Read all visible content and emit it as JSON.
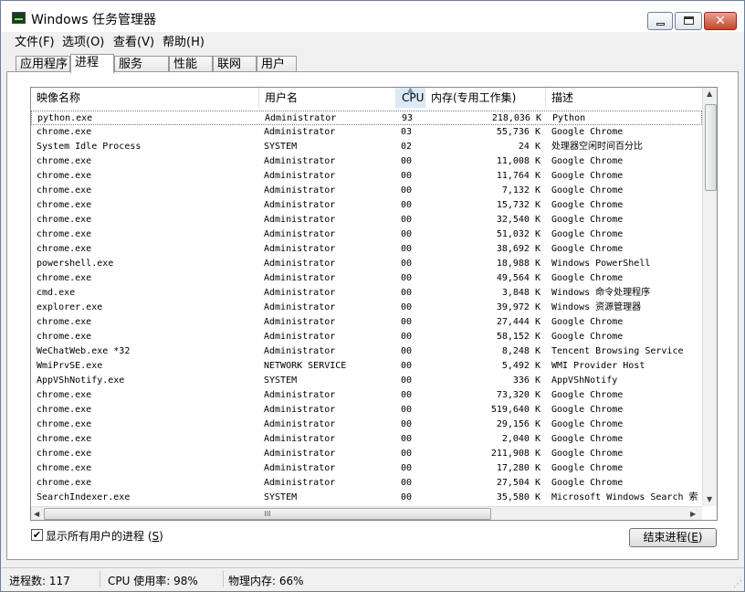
{
  "window": {
    "title": "Windows 任务管理器"
  },
  "menu": [
    "文件(F)",
    "选项(O)",
    "查看(V)",
    "帮助(H)"
  ],
  "tabs": [
    "应用程序",
    "进程",
    "服务",
    "性能",
    "联网",
    "用户"
  ],
  "active_tab": "进程",
  "columns": {
    "name": "映像名称",
    "user": "用户名",
    "cpu": "CPU",
    "mem": "内存(专用工作集)",
    "desc": "描述"
  },
  "sorted_column": "CPU",
  "processes": [
    {
      "name": "python.exe",
      "user": "Administrator",
      "cpu": "93",
      "mem": "218,036 K",
      "desc": "Python"
    },
    {
      "name": "chrome.exe",
      "user": "Administrator",
      "cpu": "03",
      "mem": "55,736 K",
      "desc": "Google Chrome"
    },
    {
      "name": "System Idle Process",
      "user": "SYSTEM",
      "cpu": "02",
      "mem": "24 K",
      "desc": "处理器空闲时间百分比"
    },
    {
      "name": "chrome.exe",
      "user": "Administrator",
      "cpu": "00",
      "mem": "11,008 K",
      "desc": "Google Chrome"
    },
    {
      "name": "chrome.exe",
      "user": "Administrator",
      "cpu": "00",
      "mem": "11,764 K",
      "desc": "Google Chrome"
    },
    {
      "name": "chrome.exe",
      "user": "Administrator",
      "cpu": "00",
      "mem": "7,132 K",
      "desc": "Google Chrome"
    },
    {
      "name": "chrome.exe",
      "user": "Administrator",
      "cpu": "00",
      "mem": "15,732 K",
      "desc": "Google Chrome"
    },
    {
      "name": "chrome.exe",
      "user": "Administrator",
      "cpu": "00",
      "mem": "32,540 K",
      "desc": "Google Chrome"
    },
    {
      "name": "chrome.exe",
      "user": "Administrator",
      "cpu": "00",
      "mem": "51,032 K",
      "desc": "Google Chrome"
    },
    {
      "name": "chrome.exe",
      "user": "Administrator",
      "cpu": "00",
      "mem": "38,692 K",
      "desc": "Google Chrome"
    },
    {
      "name": "powershell.exe",
      "user": "Administrator",
      "cpu": "00",
      "mem": "18,988 K",
      "desc": "Windows PowerShell"
    },
    {
      "name": "chrome.exe",
      "user": "Administrator",
      "cpu": "00",
      "mem": "49,564 K",
      "desc": "Google Chrome"
    },
    {
      "name": "cmd.exe",
      "user": "Administrator",
      "cpu": "00",
      "mem": "3,848 K",
      "desc": "Windows 命令处理程序"
    },
    {
      "name": "explorer.exe",
      "user": "Administrator",
      "cpu": "00",
      "mem": "39,972 K",
      "desc": "Windows 资源管理器"
    },
    {
      "name": "chrome.exe",
      "user": "Administrator",
      "cpu": "00",
      "mem": "27,444 K",
      "desc": "Google Chrome"
    },
    {
      "name": "chrome.exe",
      "user": "Administrator",
      "cpu": "00",
      "mem": "58,152 K",
      "desc": "Google Chrome"
    },
    {
      "name": "WeChatWeb.exe *32",
      "user": "Administrator",
      "cpu": "00",
      "mem": "8,248 K",
      "desc": "Tencent Browsing Service"
    },
    {
      "name": "WmiPrvSE.exe",
      "user": "NETWORK SERVICE",
      "cpu": "00",
      "mem": "5,492 K",
      "desc": "WMI Provider Host"
    },
    {
      "name": "AppVShNotify.exe",
      "user": "SYSTEM",
      "cpu": "00",
      "mem": "336 K",
      "desc": "AppVShNotify"
    },
    {
      "name": "chrome.exe",
      "user": "Administrator",
      "cpu": "00",
      "mem": "73,320 K",
      "desc": "Google Chrome"
    },
    {
      "name": "chrome.exe",
      "user": "Administrator",
      "cpu": "00",
      "mem": "519,640 K",
      "desc": "Google Chrome"
    },
    {
      "name": "chrome.exe",
      "user": "Administrator",
      "cpu": "00",
      "mem": "29,156 K",
      "desc": "Google Chrome"
    },
    {
      "name": "chrome.exe",
      "user": "Administrator",
      "cpu": "00",
      "mem": "2,040 K",
      "desc": "Google Chrome"
    },
    {
      "name": "chrome.exe",
      "user": "Administrator",
      "cpu": "00",
      "mem": "211,908 K",
      "desc": "Google Chrome"
    },
    {
      "name": "chrome.exe",
      "user": "Administrator",
      "cpu": "00",
      "mem": "17,280 K",
      "desc": "Google Chrome"
    },
    {
      "name": "chrome.exe",
      "user": "Administrator",
      "cpu": "00",
      "mem": "27,504 K",
      "desc": "Google Chrome"
    },
    {
      "name": "SearchIndexer.exe",
      "user": "SYSTEM",
      "cpu": "00",
      "mem": "35,580 K",
      "desc": "Microsoft Windows Search 索"
    }
  ],
  "show_all_users": {
    "label": "显示所有用户的进程",
    "accel": "S",
    "checked": true
  },
  "end_process_button": {
    "label": "结束进程",
    "accel": "E"
  },
  "status": {
    "process_count": "进程数: 117",
    "cpu_usage": "CPU 使用率: 98%",
    "memory": "物理内存: 66%"
  },
  "icons": {
    "app": "task-manager-icon",
    "minimize": "minimize-icon",
    "maximize": "maximize-icon",
    "close": "close-icon"
  }
}
